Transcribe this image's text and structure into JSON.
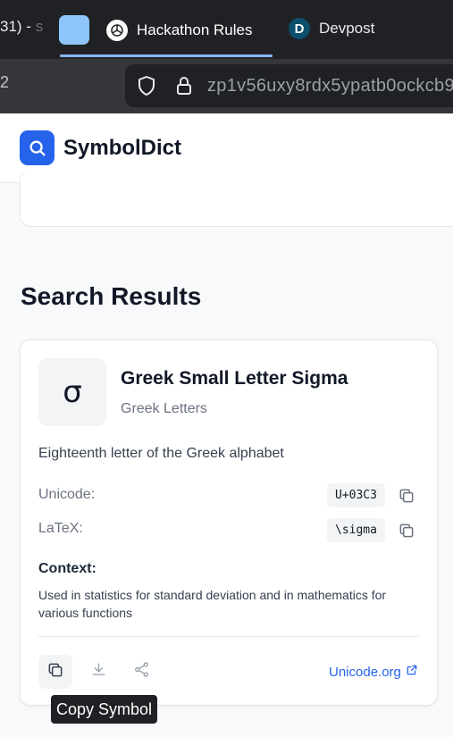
{
  "browser": {
    "partial_tab": {
      "text": "31) - ",
      "dim_text": "s"
    },
    "active_tab": {
      "title": "Hackathon Rules "
    },
    "other_tab": {
      "title": "Devpost",
      "icon_letter": "D"
    },
    "nav_partial": "2",
    "url": "zp1v56uxy8rdx5ypatb0ockcb9"
  },
  "site": {
    "brand": "SymbolDict"
  },
  "results": {
    "heading": "Search Results",
    "card": {
      "glyph": "σ",
      "name": "Greek Small Letter Sigma",
      "category": "Greek Letters",
      "description": "Eighteenth letter of the Greek alphabet",
      "unicode_label": "Unicode:",
      "unicode_value": "U+03C3",
      "latex_label": "LaTeX:",
      "latex_value": "\\sigma",
      "context_title": "Context:",
      "context_text": "Used in statistics for standard deviation and in mathematics for various functions",
      "link_text": "Unicode.org"
    },
    "tooltip": "Copy Symbol"
  },
  "colors": {
    "accent": "#2563eb",
    "chrome_dark": "#202124",
    "tab_indicator": "#8ab4f8"
  }
}
